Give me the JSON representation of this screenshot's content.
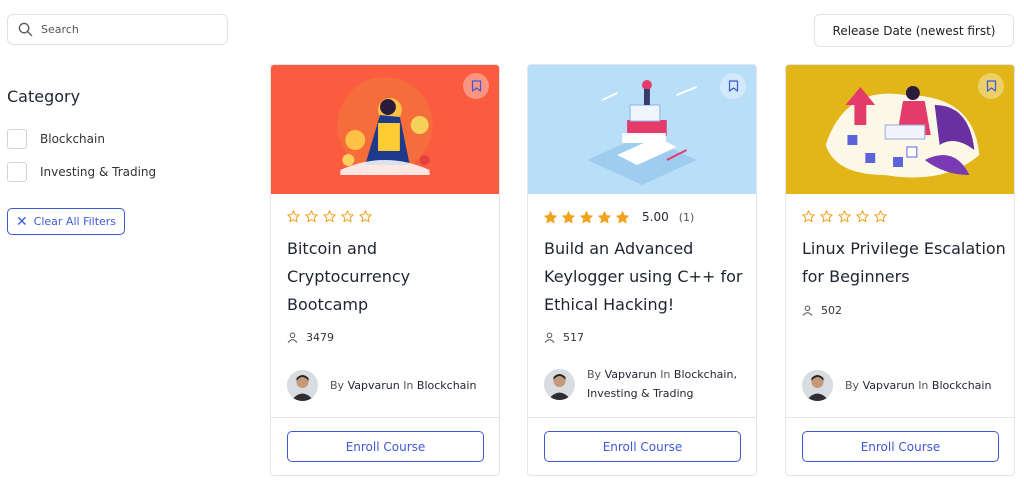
{
  "search": {
    "placeholder": "Search"
  },
  "sort": {
    "label": "Release Date (newest first)"
  },
  "sidebar": {
    "category_title": "Category",
    "categories": [
      {
        "label": "Blockchain"
      },
      {
        "label": "Investing & Trading"
      }
    ],
    "clear_label": "Clear All Filters"
  },
  "colors": {
    "accent": "#3e59d6",
    "star": "#f3a11e",
    "card1_bg": "#fb5b3f",
    "card2_bg": "#b9def8",
    "card3_bg": "#e2b518"
  },
  "courses": [
    {
      "title": "Bitcoin and Cryptocurrency Bootcamp",
      "rating": "",
      "rating_count": "",
      "stars_filled": 0,
      "students": "3479",
      "author_by": "By",
      "author_name": "Vapvarun",
      "author_in": "In",
      "author_category": "Blockchain",
      "enroll_label": "Enroll Course"
    },
    {
      "title": "Build an Advanced Keylogger using C++ for Ethical Hacking!",
      "rating": "5.00",
      "rating_count": "(1)",
      "stars_filled": 5,
      "students": "517",
      "author_by": "By",
      "author_name": "Vapvarun",
      "author_in": "In",
      "author_category": "Blockchain, Investing & Trading",
      "enroll_label": "Enroll Course"
    },
    {
      "title": "Linux Privilege Escalation for Beginners",
      "rating": "",
      "rating_count": "",
      "stars_filled": 0,
      "students": "502",
      "author_by": "By",
      "author_name": "Vapvarun",
      "author_in": "In",
      "author_category": "Blockchain",
      "enroll_label": "Enroll Course"
    }
  ]
}
